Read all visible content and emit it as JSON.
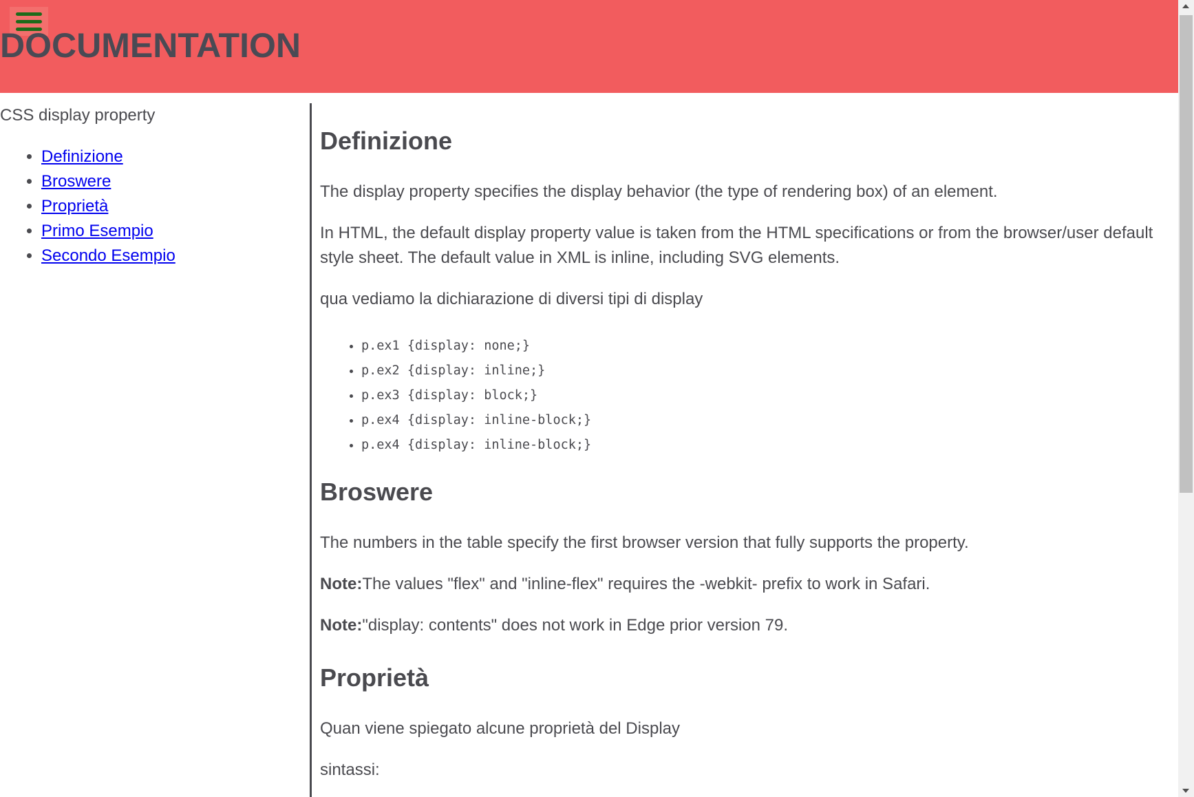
{
  "header": {
    "title": "DOCUMENTATION",
    "menu_icon": "hamburger-menu-icon"
  },
  "sidebar": {
    "title": "CSS display property",
    "items": [
      {
        "label": "Definizione"
      },
      {
        "label": "Broswere"
      },
      {
        "label": "Proprietà"
      },
      {
        "label": "Primo Esempio"
      },
      {
        "label": "Secondo Esempio"
      }
    ]
  },
  "main": {
    "definizione": {
      "heading": "Definizione",
      "p1": "The display property specifies the display behavior (the type of rendering box) of an element.",
      "p2": "In HTML, the default display property value is taken from the HTML specifications or from the browser/user default style sheet. The default value in XML is inline, including SVG elements.",
      "p3": "qua vediamo la dichiarazione di diversi tipi di display",
      "code_items": [
        "p.ex1 {display: none;}",
        "p.ex2 {display: inline;}",
        "p.ex3 {display: block;}",
        "p.ex4 {display: inline-block;}",
        "p.ex4 {display: inline-block;}"
      ]
    },
    "broswere": {
      "heading": "Broswere",
      "p1": "The numbers in the table specify the first browser version that fully supports the property.",
      "note_label": "Note:",
      "note1": "The values \"flex\" and \"inline-flex\" requires the -webkit- prefix to work in Safari.",
      "note2": "\"display: contents\" does not work in Edge prior version 79."
    },
    "proprieta": {
      "heading": "Proprietà",
      "p1": "Quan viene spiegato alcune proprietà del Display",
      "p2": "sintassi:"
    }
  },
  "colors": {
    "header_bg": "#f25c5e",
    "menu_bars": "#1d6b1a",
    "link": "#0000ee",
    "text": "#4a4a4f"
  }
}
